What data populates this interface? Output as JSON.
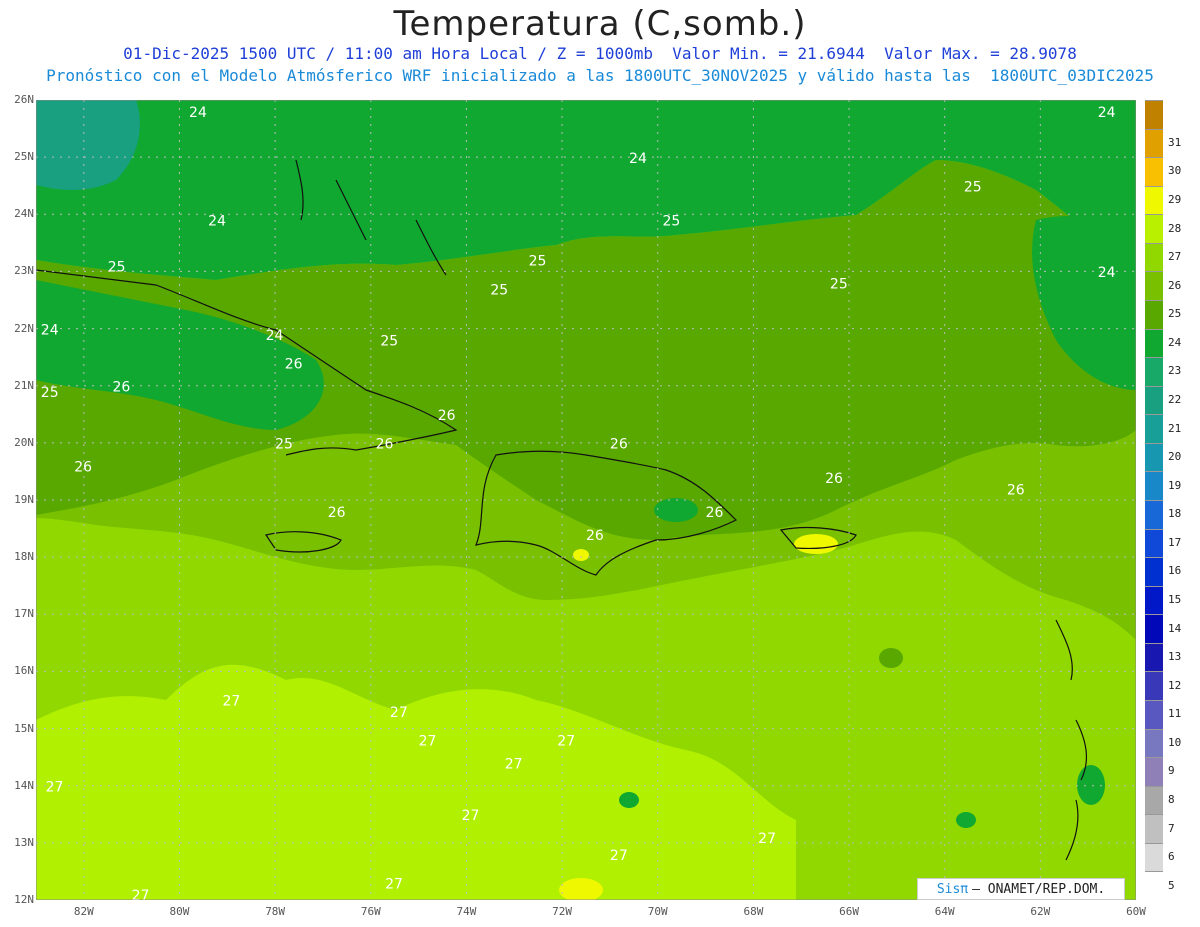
{
  "header": {
    "title": "Temperatura (C,somb.)",
    "line1": "01-Dic-2025 1500 UTC / 11:00 am Hora Local / Z = 1000mb  Valor Min. = 21.6944  Valor Max. = 28.9078",
    "line2": "Pronóstico con el Modelo Atmósferico WRF inicializado a las 1800UTC_30NOV2025 y válido hasta las  1800UTC_03DIC2025"
  },
  "axes": {
    "lat_labels": [
      "26N",
      "25N",
      "24N",
      "23N",
      "22N",
      "21N",
      "20N",
      "19N",
      "18N",
      "17N",
      "16N",
      "15N",
      "14N",
      "13N",
      "12N"
    ],
    "lon_labels": [
      "82W",
      "80W",
      "78W",
      "76W",
      "74W",
      "72W",
      "70W",
      "68W",
      "66W",
      "64W",
      "62W",
      "60W"
    ]
  },
  "contour_labels": [
    {
      "text": "24",
      "lon": -79.8,
      "lat": 25.7
    },
    {
      "text": "24",
      "lon": -79.4,
      "lat": 23.8
    },
    {
      "text": "24",
      "lon": -70.6,
      "lat": 24.9
    },
    {
      "text": "24",
      "lon": -60.8,
      "lat": 25.7
    },
    {
      "text": "24",
      "lon": -60.8,
      "lat": 22.9
    },
    {
      "text": "24",
      "lon": -82.9,
      "lat": 21.9
    },
    {
      "text": "24",
      "lon": -78.2,
      "lat": 21.8
    },
    {
      "text": "25",
      "lon": -81.5,
      "lat": 23.0
    },
    {
      "text": "25",
      "lon": -73.5,
      "lat": 22.6
    },
    {
      "text": "25",
      "lon": -75.8,
      "lat": 21.7
    },
    {
      "text": "25",
      "lon": -72.7,
      "lat": 23.1
    },
    {
      "text": "25",
      "lon": -69.9,
      "lat": 23.8
    },
    {
      "text": "25",
      "lon": -66.4,
      "lat": 22.7
    },
    {
      "text": "25",
      "lon": -63.6,
      "lat": 24.4
    },
    {
      "text": "25",
      "lon": -82.9,
      "lat": 20.8
    },
    {
      "text": "25",
      "lon": -78.0,
      "lat": 19.9
    },
    {
      "text": "26",
      "lon": -81.4,
      "lat": 20.9
    },
    {
      "text": "26",
      "lon": -77.8,
      "lat": 21.3
    },
    {
      "text": "26",
      "lon": -74.6,
      "lat": 20.4
    },
    {
      "text": "26",
      "lon": -75.9,
      "lat": 19.9
    },
    {
      "text": "26",
      "lon": -82.2,
      "lat": 19.5
    },
    {
      "text": "26",
      "lon": -76.9,
      "lat": 18.7
    },
    {
      "text": "26",
      "lon": -71.0,
      "lat": 19.9
    },
    {
      "text": "26",
      "lon": -71.5,
      "lat": 18.3
    },
    {
      "text": "26",
      "lon": -69.0,
      "lat": 18.7
    },
    {
      "text": "26",
      "lon": -66.5,
      "lat": 19.3
    },
    {
      "text": "26",
      "lon": -62.7,
      "lat": 19.1
    },
    {
      "text": "27",
      "lon": -79.1,
      "lat": 15.4
    },
    {
      "text": "27",
      "lon": -75.6,
      "lat": 15.2
    },
    {
      "text": "27",
      "lon": -75.0,
      "lat": 14.7
    },
    {
      "text": "27",
      "lon": -73.2,
      "lat": 14.3
    },
    {
      "text": "27",
      "lon": -72.1,
      "lat": 14.7
    },
    {
      "text": "27",
      "lon": -82.8,
      "lat": 13.9
    },
    {
      "text": "27",
      "lon": -74.1,
      "lat": 13.4
    },
    {
      "text": "27",
      "lon": -71.0,
      "lat": 12.7
    },
    {
      "text": "27",
      "lon": -67.9,
      "lat": 13.0
    },
    {
      "text": "27",
      "lon": -75.7,
      "lat": 12.2
    },
    {
      "text": "27",
      "lon": -81.0,
      "lat": 12.0
    }
  ],
  "colorbar": {
    "labels": [
      "5",
      "6",
      "7",
      "8",
      "9",
      "10",
      "11",
      "12",
      "13",
      "14",
      "15",
      "16",
      "17",
      "18",
      "19",
      "20",
      "21",
      "22",
      "23",
      "24",
      "25",
      "26",
      "27",
      "28",
      "29",
      "30",
      "31"
    ],
    "colors": [
      "#ffffff",
      "#dadada",
      "#c0c0c0",
      "#a8a8a8",
      "#9080b8",
      "#7878c0",
      "#5858c0",
      "#3838b8",
      "#1818b0",
      "#0008b8",
      "#0018c8",
      "#0030d0",
      "#1048d8",
      "#1868d8",
      "#1888c8",
      "#1898b0",
      "#18a098",
      "#18a080",
      "#18a868",
      "#10a830",
      "#58a800",
      "#78c000",
      "#90d800",
      "#b8f000",
      "#f0f800",
      "#f8c000",
      "#e0a000",
      "#c08000"
    ]
  },
  "credit": {
    "sis": "Sisπ",
    "text": "– ONAMET/REP.DOM."
  }
}
